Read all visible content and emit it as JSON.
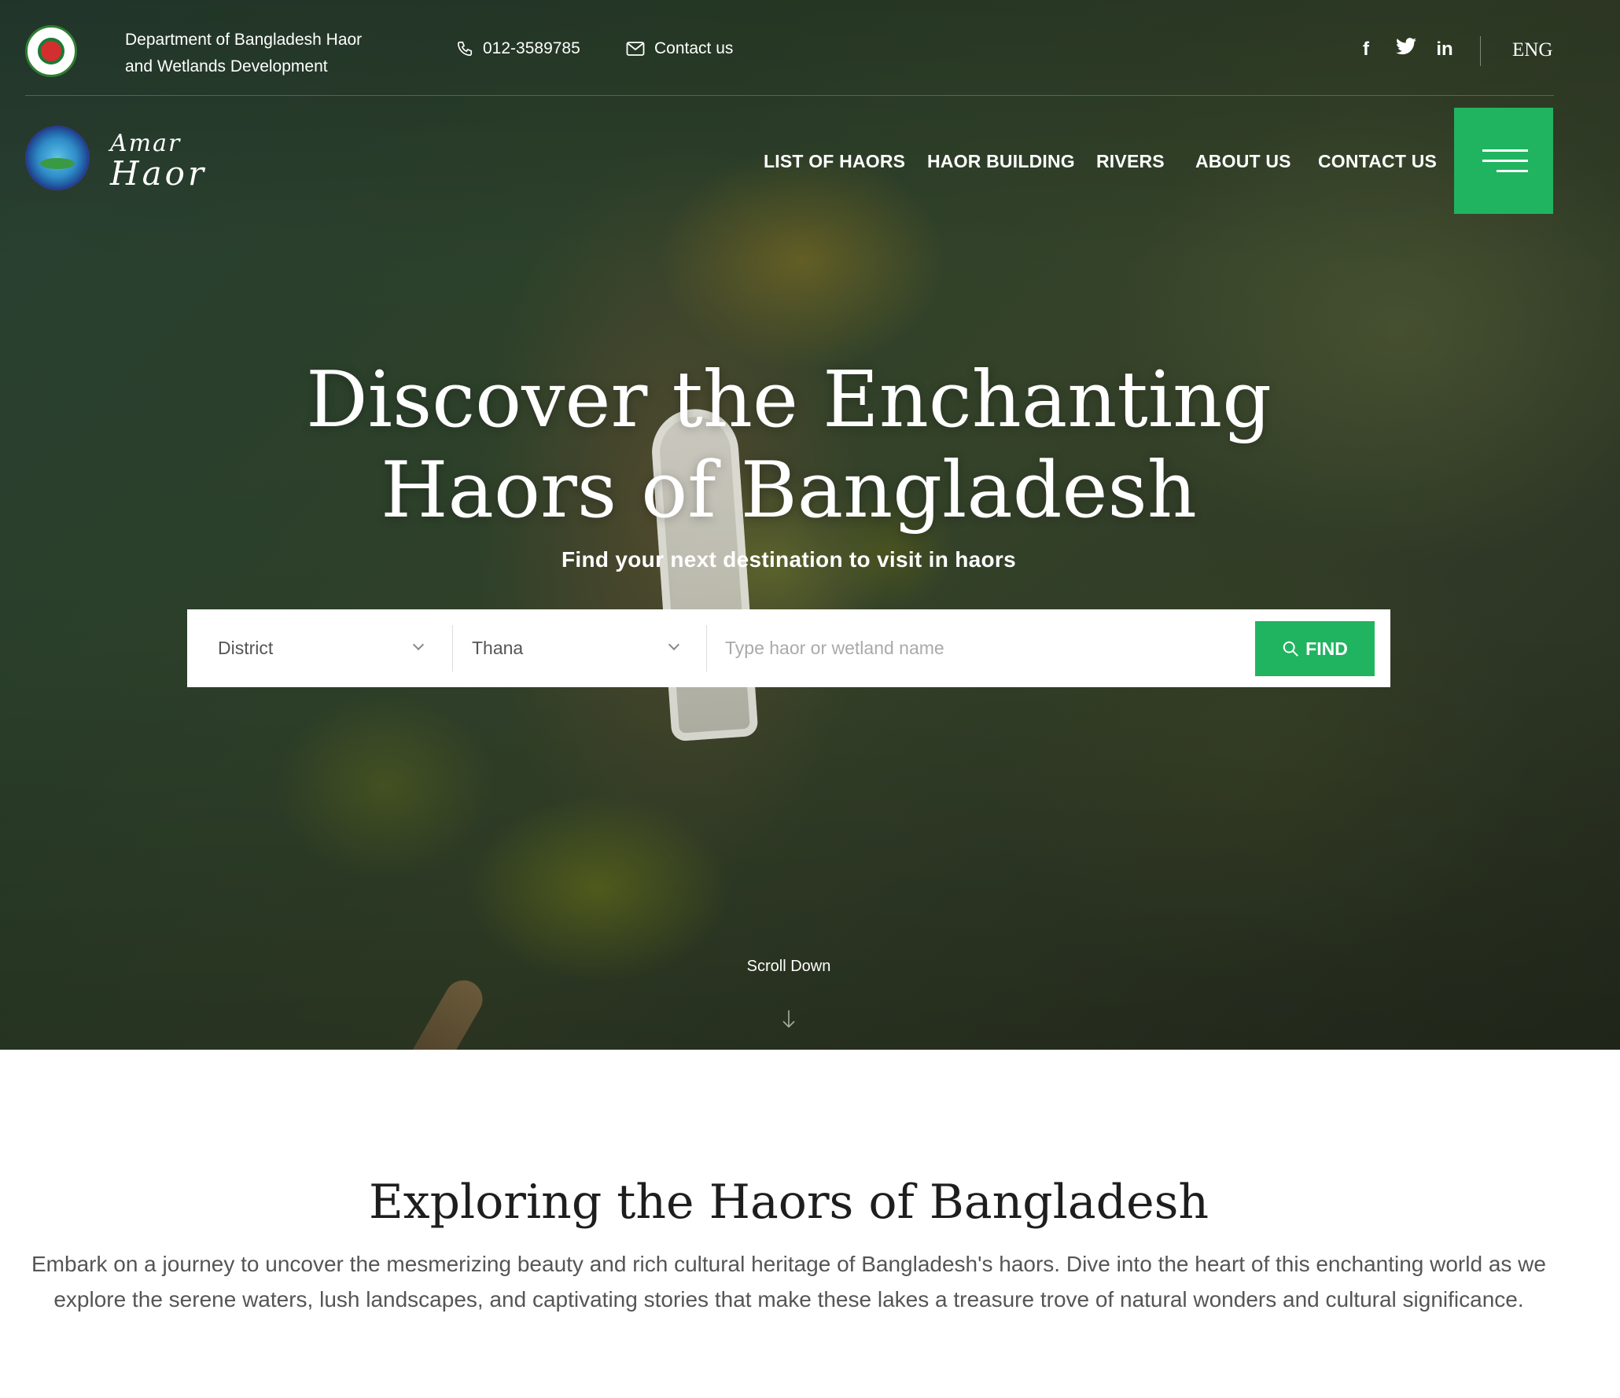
{
  "topbar": {
    "department": "Department of Bangladesh Haor and Wetlands Development",
    "phone": "012-3589785",
    "contact": "Contact us",
    "social": [
      {
        "icon": "facebook-icon",
        "glyph": "f"
      },
      {
        "icon": "twitter-icon",
        "glyph": "🐦"
      },
      {
        "icon": "linkedin-icon",
        "glyph": "in"
      }
    ],
    "language": "ENG"
  },
  "brand": {
    "line1": "Amar",
    "line2": "Haor"
  },
  "nav": {
    "items": [
      "LIST OF HAORS",
      "HAOR BUILDING",
      "RIVERS",
      "ABOUT US",
      "CONTACT US"
    ]
  },
  "hero": {
    "title_line1": "Discover the Enchanting",
    "title_line2": "Haors of Bangladesh",
    "subtitle": "Find your next destination to visit in haors",
    "scroll": "Scroll Down"
  },
  "search": {
    "district": "District",
    "thana": "Thana",
    "placeholder": "Type haor or wetland name",
    "button": "FIND"
  },
  "about": {
    "title": "Exploring the Haors of Bangladesh",
    "text": "Embark on a journey to uncover the mesmerizing beauty and rich cultural heritage of Bangladesh's haors. Dive into the heart of this enchanting world as we explore the serene waters, lush landscapes, and captivating stories that make these lakes a treasure trove of natural wonders and cultural significance."
  },
  "colors": {
    "accent": "#21b460",
    "heading": "#1e1e1e",
    "body_text": "#555555"
  }
}
